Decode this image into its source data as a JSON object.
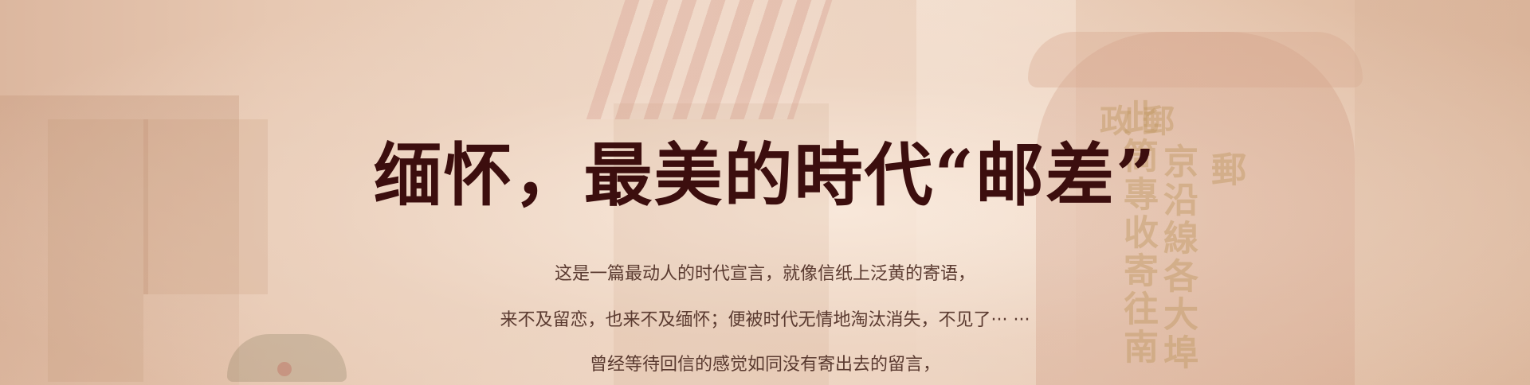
{
  "banner": {
    "headline": "缅怀，最美的時代“邮差”",
    "lines": [
      "这是一篇最动人的时代宣言，就像信纸上泛黄的寄语，",
      "来不及留恋，也来不及缅怀；便被时代无情地淘汰消失，不见了··· ···",
      "曾经等待回信的感觉如同没有寄出去的留言，"
    ],
    "background_signage": {
      "mailbox_top": "政 郵",
      "mailbox_column_1": "此筒專收寄往南",
      "mailbox_column_2": "京沿線各大埠",
      "mailbox_column_3": "郵"
    },
    "colors": {
      "headline": "#3c0e0e",
      "body_text": "#5a3a30",
      "background": "#e8c9b4"
    }
  }
}
